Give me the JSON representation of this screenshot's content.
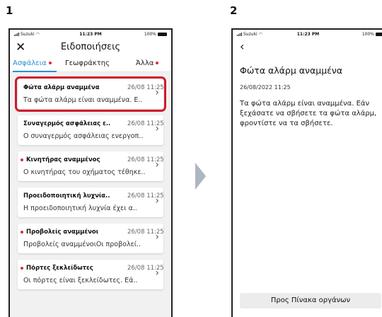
{
  "steps": {
    "first": "1",
    "second": "2"
  },
  "statusbar": {
    "carrier": "Suzuki",
    "time": "11:23 PM",
    "battery": "100%"
  },
  "screen1": {
    "title": "Ειδοποιήσεις",
    "tabs": [
      {
        "label": "Ασφάλεια",
        "active": true,
        "dot": true
      },
      {
        "label": "Γεωφράκτης",
        "active": false,
        "dot": false
      },
      {
        "label": "Άλλα",
        "active": false,
        "dot": true
      }
    ],
    "notifications": [
      {
        "title": "Φώτα αλάρμ αναμμένα",
        "date": "26/08 11:25",
        "body": "Τα φώτα αλάρμ είναι αναμμένα. Ε..",
        "unread": false,
        "highlighted": true
      },
      {
        "title": "Συναγερμός ασφάλειας ε..",
        "date": "26/08 11:25",
        "body": "Ο συναγερμός ασφάλειας ενεργοπ..",
        "unread": false,
        "highlighted": false
      },
      {
        "title": "Κινητήρας αναμμένος",
        "date": "26/08 11:25",
        "body": "Ο κινητήρας του οχήματος τέθηκε..",
        "unread": true,
        "highlighted": false
      },
      {
        "title": "Προειδοποιητική λυχνία..",
        "date": "26/08 11:25",
        "body": "Η προειδοποιητική λυχνία έχει α..",
        "unread": false,
        "highlighted": false
      },
      {
        "title": "Προβολείς αναμμένοι",
        "date": "26/08 11:25",
        "body": "Προβολείς αναμμένοιΟι προβολεί..",
        "unread": true,
        "highlighted": false
      },
      {
        "title": "Πόρτες ξεκλείδωτες",
        "date": "26/08 11:25",
        "body": "Οι πόρτες είναι ξεκλείδωτες. Εά..",
        "unread": true,
        "highlighted": false
      }
    ]
  },
  "screen2": {
    "title": "Φώτα αλάρμ αναμμένα",
    "date": "26/08/2022 11:25",
    "body": "Τα φώτα αλάρμ είναι αναμμένα. Εάν ξεχάσατε να σβήσετε τα φώτα αλάρμ, φροντίστε να τα σβήσετε.",
    "button": "Προς Πίνακα οργάνων"
  },
  "colors": {
    "accent": "#2a8fd6",
    "alert": "#e0283c",
    "highlight_frame": "#d11a2a",
    "arrow": "#aeb6bf"
  }
}
